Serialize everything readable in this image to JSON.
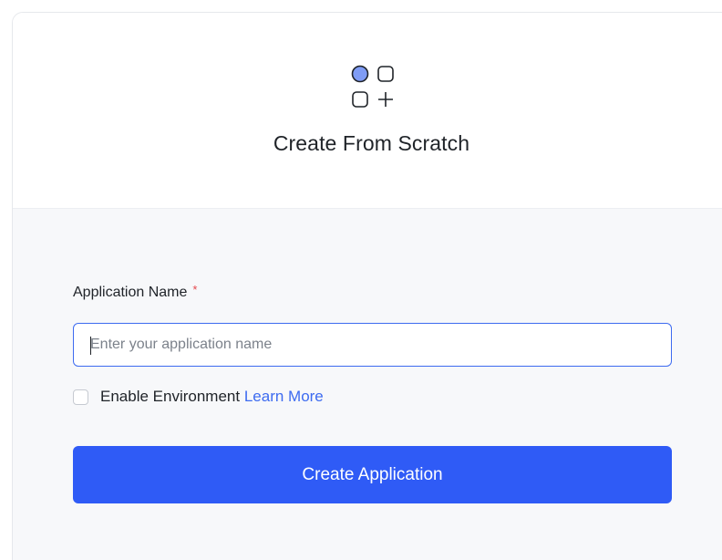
{
  "header": {
    "icon": "apps-grid-plus-icon",
    "title": "Create From Scratch"
  },
  "form": {
    "name_label": "Application Name",
    "required_marker": "*",
    "name_input": {
      "value": "",
      "placeholder": "Enter your application name"
    },
    "environment": {
      "checked": false,
      "label": "Enable Environment",
      "link_label": "Learn More"
    },
    "submit_label": "Create Application"
  },
  "colors": {
    "accent": "#2f5bf6",
    "link": "#3d6bf0",
    "required": "#e5484d",
    "icon_fill": "#7f9cf5"
  }
}
